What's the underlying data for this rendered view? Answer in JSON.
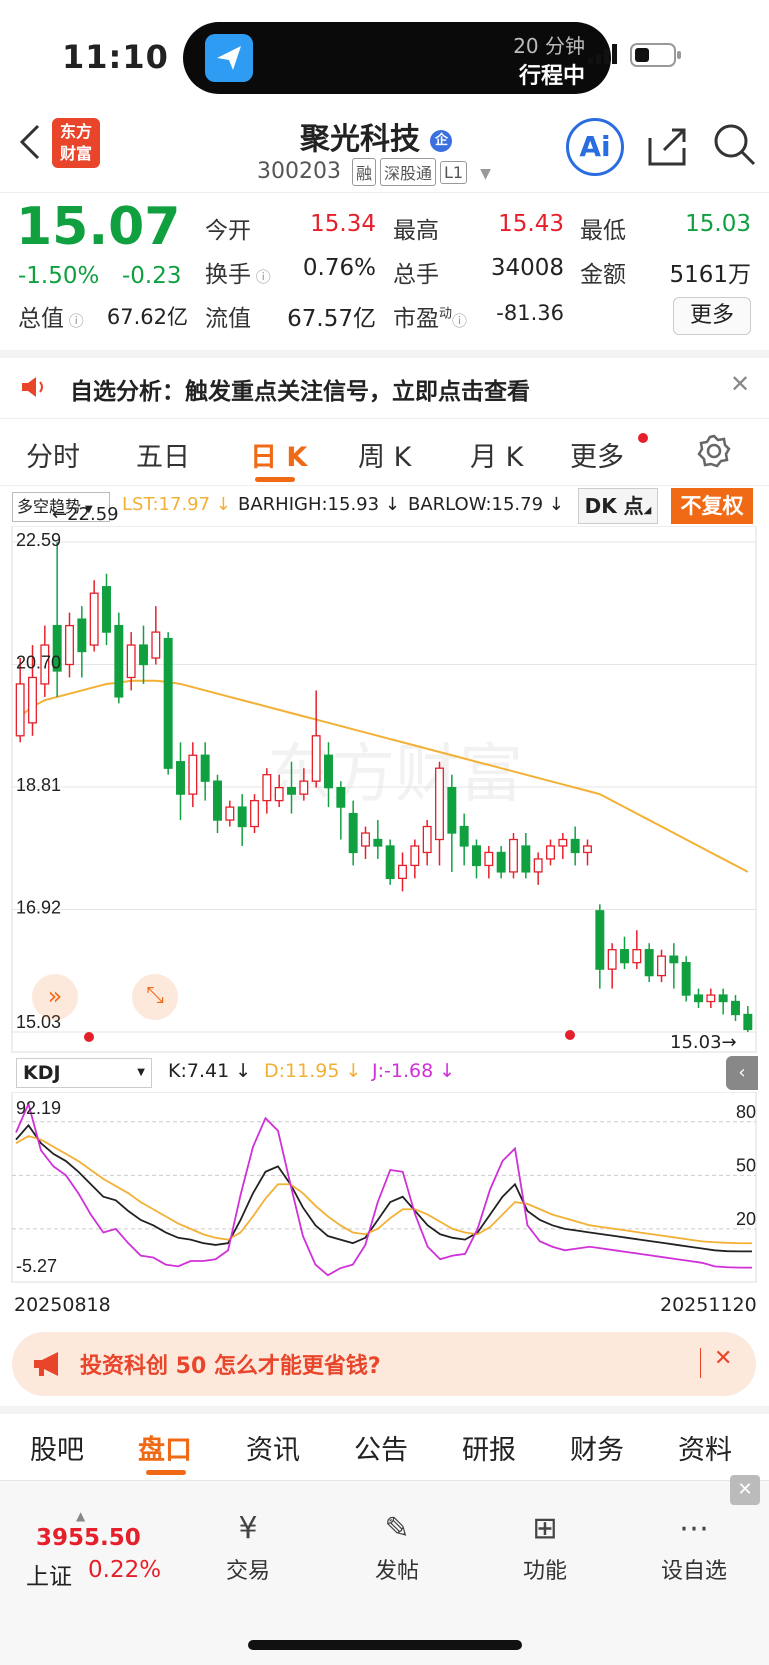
{
  "status": {
    "time": "11:10",
    "island_line1": "20 分钟",
    "island_line2": "行程中"
  },
  "header": {
    "logo_line1": "东方",
    "logo_line2": "财富",
    "name": "聚光科技",
    "name_badge": "企",
    "code": "300203",
    "tags": [
      "融",
      "深股通",
      "L1"
    ],
    "ai_label": "Ai"
  },
  "quote": {
    "price": "15.07",
    "change_pct": "-1.50%",
    "change": "-0.23",
    "open_label": "今开",
    "open": "15.34",
    "high_label": "最高",
    "high": "15.43",
    "low_label": "最低",
    "low": "15.03",
    "turnover_label": "换手",
    "turnover": "0.76%",
    "volume_label": "总手",
    "volume": "34008",
    "amount_label": "金额",
    "amount": "5161万",
    "mktcap_label": "总值",
    "mktcap": "67.62亿",
    "float_label": "流值",
    "float": "67.57亿",
    "pe_label": "市盈",
    "pe_sup": "动",
    "pe": "-81.36",
    "more_label": "更多"
  },
  "notice": {
    "text": "自选分析：触发重点关注信号，立即点击查看"
  },
  "tabs": [
    "分时",
    "五日",
    "日 K",
    "周 K",
    "月 K",
    "更多"
  ],
  "active_tab": 2,
  "chart_toolbar": {
    "indicator": "多空趋势",
    "lst": "LST:17.97",
    "barhigh": "BARHIGH:15.93",
    "barlow": "BARLOW:15.79",
    "dk": "DK 点",
    "fq": "不复权"
  },
  "kdj_toolbar": {
    "name": "KDJ",
    "k": "K:7.41",
    "d": "D:11.95",
    "j": "J:-1.68"
  },
  "chart_data": [
    {
      "type": "candlestick",
      "title": "",
      "y_ticks": [
        "22.59",
        "20.70",
        "18.81",
        "16.92",
        "15.03"
      ],
      "ylim": [
        15.03,
        22.59
      ],
      "max_label": "22.59",
      "min_label": "15.03",
      "colors": {
        "up": "#e5202b",
        "down": "#10a040",
        "ma": "#f2b035"
      },
      "candles": [
        {
          "o": 19.6,
          "c": 20.4,
          "h": 20.8,
          "l": 19.5
        },
        {
          "o": 19.8,
          "c": 20.5,
          "h": 21.0,
          "l": 19.6
        },
        {
          "o": 20.4,
          "c": 21.0,
          "h": 21.3,
          "l": 20.2
        },
        {
          "o": 21.3,
          "c": 20.6,
          "h": 22.59,
          "l": 20.2
        },
        {
          "o": 20.7,
          "c": 21.3,
          "h": 21.5,
          "l": 20.5
        },
        {
          "o": 21.4,
          "c": 20.9,
          "h": 21.6,
          "l": 20.5
        },
        {
          "o": 21.0,
          "c": 21.8,
          "h": 22.0,
          "l": 20.9
        },
        {
          "o": 21.9,
          "c": 21.2,
          "h": 22.1,
          "l": 21.0
        },
        {
          "o": 21.3,
          "c": 20.2,
          "h": 21.5,
          "l": 20.1
        },
        {
          "o": 20.5,
          "c": 21.0,
          "h": 21.2,
          "l": 20.3
        },
        {
          "o": 21.0,
          "c": 20.7,
          "h": 21.3,
          "l": 20.4
        },
        {
          "o": 20.8,
          "c": 21.2,
          "h": 21.6,
          "l": 20.7
        },
        {
          "o": 21.1,
          "c": 19.1,
          "h": 21.2,
          "l": 19.0
        },
        {
          "o": 19.2,
          "c": 18.7,
          "h": 19.5,
          "l": 18.3
        },
        {
          "o": 18.7,
          "c": 19.3,
          "h": 19.5,
          "l": 18.5
        },
        {
          "o": 19.3,
          "c": 18.9,
          "h": 19.5,
          "l": 18.6
        },
        {
          "o": 18.9,
          "c": 18.3,
          "h": 19.0,
          "l": 18.1
        },
        {
          "o": 18.3,
          "c": 18.5,
          "h": 18.6,
          "l": 18.2
        },
        {
          "o": 18.5,
          "c": 18.2,
          "h": 18.7,
          "l": 17.9
        },
        {
          "o": 18.2,
          "c": 18.6,
          "h": 18.7,
          "l": 18.1
        },
        {
          "o": 18.6,
          "c": 19.0,
          "h": 19.1,
          "l": 18.4
        },
        {
          "o": 18.6,
          "c": 18.8,
          "h": 19.0,
          "l": 18.5
        },
        {
          "o": 18.8,
          "c": 18.7,
          "h": 19.2,
          "l": 18.4
        },
        {
          "o": 18.7,
          "c": 18.9,
          "h": 19.1,
          "l": 18.6
        },
        {
          "o": 18.9,
          "c": 19.6,
          "h": 20.3,
          "l": 18.8
        },
        {
          "o": 19.3,
          "c": 18.8,
          "h": 19.5,
          "l": 18.5
        },
        {
          "o": 18.8,
          "c": 18.5,
          "h": 18.9,
          "l": 18.0
        },
        {
          "o": 18.4,
          "c": 17.8,
          "h": 18.6,
          "l": 17.6
        },
        {
          "o": 17.9,
          "c": 18.1,
          "h": 18.2,
          "l": 17.7
        },
        {
          "o": 18.0,
          "c": 17.9,
          "h": 18.3,
          "l": 17.7
        },
        {
          "o": 17.9,
          "c": 17.4,
          "h": 18.0,
          "l": 17.3
        },
        {
          "o": 17.4,
          "c": 17.6,
          "h": 17.8,
          "l": 17.2
        },
        {
          "o": 17.6,
          "c": 17.9,
          "h": 18.0,
          "l": 17.4
        },
        {
          "o": 17.8,
          "c": 18.2,
          "h": 18.3,
          "l": 17.6
        },
        {
          "o": 18.0,
          "c": 19.1,
          "h": 19.2,
          "l": 17.6
        },
        {
          "o": 18.8,
          "c": 18.1,
          "h": 19.0,
          "l": 17.5
        },
        {
          "o": 18.2,
          "c": 17.9,
          "h": 18.4,
          "l": 17.6
        },
        {
          "o": 17.9,
          "c": 17.6,
          "h": 18.0,
          "l": 17.4
        },
        {
          "o": 17.6,
          "c": 17.8,
          "h": 17.9,
          "l": 17.4
        },
        {
          "o": 17.8,
          "c": 17.5,
          "h": 17.9,
          "l": 17.4
        },
        {
          "o": 17.5,
          "c": 18.0,
          "h": 18.1,
          "l": 17.4
        },
        {
          "o": 17.9,
          "c": 17.5,
          "h": 18.1,
          "l": 17.4
        },
        {
          "o": 17.5,
          "c": 17.7,
          "h": 17.8,
          "l": 17.3
        },
        {
          "o": 17.7,
          "c": 17.9,
          "h": 18.0,
          "l": 17.6
        },
        {
          "o": 17.9,
          "c": 18.0,
          "h": 18.1,
          "l": 17.7
        },
        {
          "o": 18.0,
          "c": 17.8,
          "h": 18.2,
          "l": 17.6
        },
        {
          "o": 17.8,
          "c": 17.9,
          "h": 18.0,
          "l": 17.6
        },
        {
          "o": 16.9,
          "c": 16.0,
          "h": 17.0,
          "l": 15.7
        },
        {
          "o": 16.0,
          "c": 16.3,
          "h": 16.4,
          "l": 15.7
        },
        {
          "o": 16.3,
          "c": 16.1,
          "h": 16.5,
          "l": 16.0
        },
        {
          "o": 16.1,
          "c": 16.3,
          "h": 16.6,
          "l": 16.0
        },
        {
          "o": 16.3,
          "c": 15.9,
          "h": 16.4,
          "l": 15.8
        },
        {
          "o": 15.9,
          "c": 16.2,
          "h": 16.3,
          "l": 15.8
        },
        {
          "o": 16.2,
          "c": 16.1,
          "h": 16.4,
          "l": 15.7
        },
        {
          "o": 16.1,
          "c": 15.6,
          "h": 16.2,
          "l": 15.5
        },
        {
          "o": 15.6,
          "c": 15.5,
          "h": 15.7,
          "l": 15.4
        },
        {
          "o": 15.5,
          "c": 15.6,
          "h": 15.7,
          "l": 15.4
        },
        {
          "o": 15.6,
          "c": 15.5,
          "h": 15.7,
          "l": 15.3
        },
        {
          "o": 15.5,
          "c": 15.3,
          "h": 15.6,
          "l": 15.2
        },
        {
          "o": 15.3,
          "c": 15.07,
          "h": 15.43,
          "l": 15.03
        }
      ],
      "ma": [
        19.9,
        20.05,
        20.15,
        20.2,
        20.25,
        20.3,
        20.35,
        20.4,
        20.42,
        20.45,
        20.45,
        20.45,
        20.43,
        20.4,
        20.35,
        20.3,
        20.25,
        20.2,
        20.15,
        20.1,
        20.05,
        20.0,
        19.95,
        19.9,
        19.85,
        19.8,
        19.75,
        19.7,
        19.65,
        19.6,
        19.55,
        19.5,
        19.45,
        19.4,
        19.35,
        19.3,
        19.25,
        19.2,
        19.15,
        19.1,
        19.05,
        19.0,
        18.95,
        18.9,
        18.85,
        18.8,
        18.75,
        18.7,
        18.6,
        18.5,
        18.4,
        18.3,
        18.2,
        18.1,
        18.0,
        17.9,
        17.8,
        17.7,
        17.6,
        17.5
      ]
    },
    {
      "type": "line",
      "title": "",
      "x_start": "20250818",
      "x_end": "20251120",
      "ylim": [
        -5.27,
        92.19
      ],
      "y_ticks_left": [
        "92.19",
        "-5.27"
      ],
      "y_ticks_right": [
        "80",
        "50",
        "20"
      ],
      "series": [
        {
          "name": "K",
          "color": "#222222",
          "values": [
            70,
            78,
            68,
            62,
            58,
            52,
            45,
            38,
            36,
            30,
            25,
            22,
            18,
            15,
            14,
            12,
            11,
            12,
            25,
            40,
            52,
            55,
            45,
            32,
            22,
            16,
            14,
            12,
            15,
            25,
            35,
            38,
            30,
            22,
            17,
            15,
            14,
            18,
            28,
            38,
            45,
            30,
            25,
            22,
            20,
            19,
            18,
            17,
            16,
            15,
            14,
            13,
            12,
            11,
            10,
            9,
            8,
            7.5,
            7.41,
            7.41
          ]
        },
        {
          "name": "D",
          "color": "#f2b035",
          "values": [
            68,
            72,
            70,
            66,
            62,
            58,
            53,
            48,
            44,
            40,
            35,
            31,
            27,
            23,
            20,
            17,
            15,
            14,
            18,
            27,
            37,
            45,
            45,
            40,
            33,
            27,
            22,
            18,
            17,
            20,
            26,
            31,
            31,
            28,
            24,
            20,
            18,
            17,
            21,
            28,
            35,
            34,
            31,
            28,
            26,
            24,
            22,
            21,
            20,
            19,
            18,
            17,
            16,
            15,
            14,
            13,
            12.5,
            12.2,
            11.95,
            11.95
          ]
        },
        {
          "name": "J",
          "color": "#d030d8",
          "values": [
            74,
            90,
            64,
            55,
            50,
            40,
            28,
            18,
            20,
            12,
            5,
            4,
            0,
            -1,
            2,
            2,
            3,
            8,
            39,
            66,
            82,
            75,
            45,
            16,
            0,
            -6,
            -2,
            0,
            11,
            35,
            53,
            52,
            28,
            10,
            3,
            5,
            6,
            20,
            42,
            58,
            65,
            22,
            13,
            10,
            8,
            9,
            10,
            9,
            8,
            7,
            6,
            5,
            4,
            3,
            2,
            1,
            -1,
            -1.5,
            -1.68,
            -1.68
          ]
        }
      ]
    }
  ],
  "ad": {
    "text": "投资科创 50 怎么才能更省钱?"
  },
  "subtabs": [
    "股吧",
    "盘口",
    "资讯",
    "公告",
    "研报",
    "财务",
    "资料"
  ],
  "active_subtab": 1,
  "bottom": {
    "index_value": "3955.50",
    "index_name": "上证",
    "index_pct": "0.22%",
    "items": [
      "交易",
      "发帖",
      "功能",
      "设自选"
    ]
  },
  "watermark": "东方财富"
}
